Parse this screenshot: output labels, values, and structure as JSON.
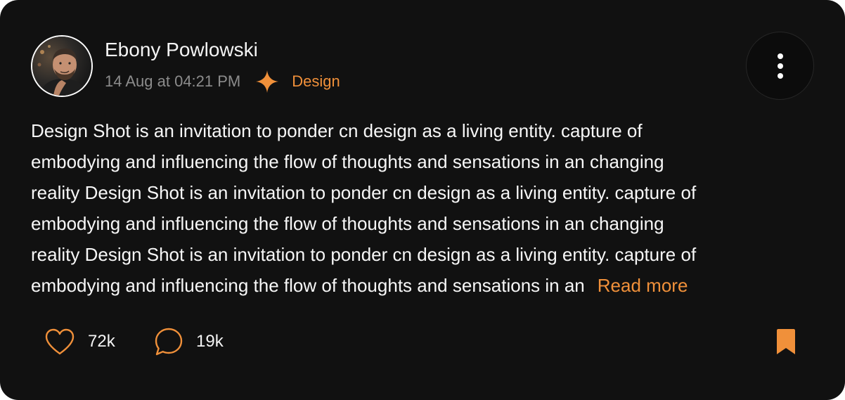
{
  "post": {
    "author": {
      "name": "Ebony Powlowski",
      "avatar": "avatar-photo"
    },
    "timestamp": "14 Aug at 04:21 PM",
    "category": {
      "icon": "sparkle-icon",
      "label": "Design"
    },
    "menu_icon": "more-vertical-icon",
    "body_lines": [
      "Design Shot is an invitation to ponder cn design as a living entity. capture of",
      "embodying and influencing the flow of thoughts and sensations in an changing",
      "reality Design Shot is an invitation to ponder cn design as a living entity. capture of",
      "embodying and influencing the flow of thoughts and sensations in an changing",
      "reality Design Shot is an invitation to ponder cn design as a living entity. capture of",
      "embodying and influencing the flow of thoughts and sensations in an"
    ],
    "read_more": "Read more",
    "actions": {
      "likes": {
        "icon": "heart-icon",
        "count": "72k"
      },
      "comments": {
        "icon": "comment-icon",
        "count": "19k"
      },
      "bookmark": {
        "icon": "bookmark-icon"
      }
    }
  },
  "colors": {
    "card_background": "#111111",
    "accent": "#f0903a",
    "text": "#f7f7f7",
    "muted_text": "#8c8c8c"
  }
}
